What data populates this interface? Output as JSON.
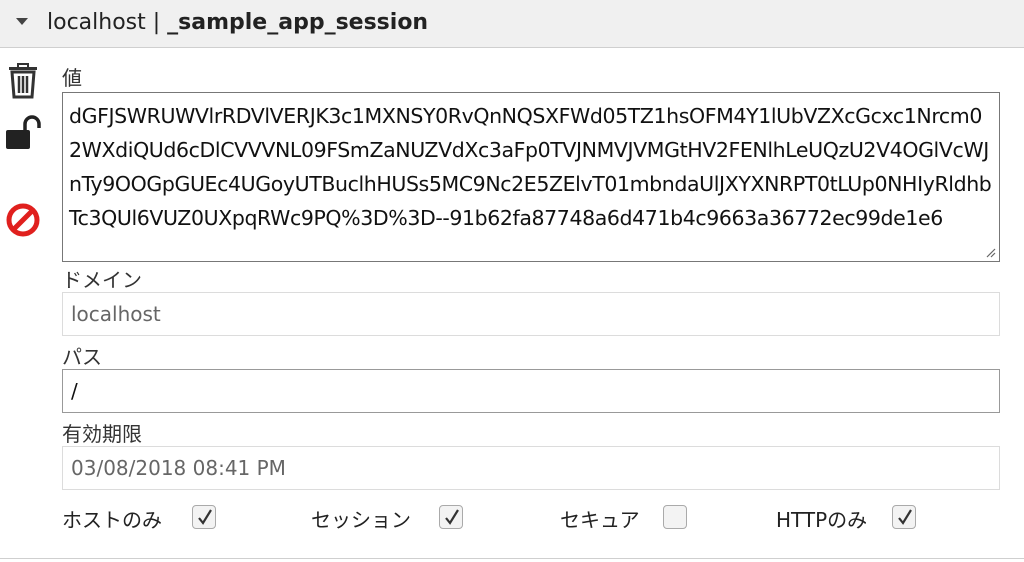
{
  "header": {
    "host": "localhost | ",
    "cookie_name": "_sample_app_session"
  },
  "icons": {
    "delete": "trash-icon",
    "lock": "unlock-icon",
    "block": "block-icon"
  },
  "value": {
    "label": "値",
    "text": "dGFJSWRUWVlrRDVlVERJK3c1MXNSY0RvQnNQSXFWd05TZ1hsOFM4Y1lUbVZXcGcxc1Nrcm02WXdiQUd6cDlCVVVNL09FSmZaNUZVdXc3aFp0TVJNMVJVMGtHV2FENlhLeUQzU2V4OGlVcWJnTy9OOGpGUEc4UGoyUTBuclhHUSs5MC9Nc2E5ZElvT01mbndaUlJXYXNRPT0tLUp0NHIyRldhbTc3QUl6VUZ0UXpqRWc9PQ%3D%3D--91b62fa87748a6d471b4c9663a36772ec99de1e6"
  },
  "domain": {
    "label": "ドメイン",
    "value": "localhost"
  },
  "path": {
    "label": "パス",
    "value": "/"
  },
  "expires": {
    "label": "有効期限",
    "value": "03/08/2018 08:41 PM"
  },
  "flags": {
    "host_only": {
      "label": "ホストのみ",
      "checked": true
    },
    "session": {
      "label": "セッション",
      "checked": true
    },
    "secure": {
      "label": "セキュア",
      "checked": false
    },
    "http_only": {
      "label": "HTTPのみ",
      "checked": true
    }
  }
}
